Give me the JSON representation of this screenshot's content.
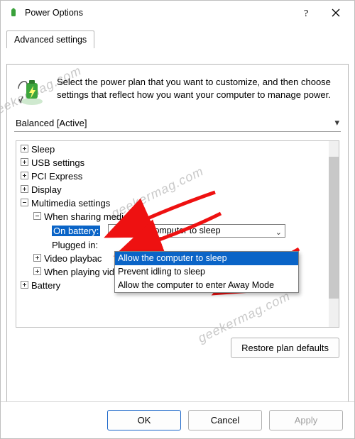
{
  "window": {
    "title": "Power Options"
  },
  "tab": {
    "label": "Advanced settings"
  },
  "intro": {
    "text": "Select the power plan that you want to customize, and then choose settings that reflect how you want your computer to manage power."
  },
  "plan": {
    "selected": "Balanced [Active]"
  },
  "tree": {
    "sleep": "Sleep",
    "usb": "USB settings",
    "pci": "PCI Express",
    "display": "Display",
    "multimedia": "Multimedia settings",
    "sharing": "When sharing media",
    "on_battery_label": "On battery:",
    "on_battery_value": "Allow the computer to sleep",
    "plugged_in_label": "Plugged in:",
    "video_playback": "Video playbac",
    "when_playing": "When playing video",
    "battery": "Battery"
  },
  "dropdown": {
    "opt1": "Allow the computer to sleep",
    "opt2": "Prevent idling to sleep",
    "opt3": "Allow the computer to enter Away Mode"
  },
  "buttons": {
    "restore": "Restore plan defaults",
    "ok": "OK",
    "cancel": "Cancel",
    "apply": "Apply"
  },
  "watermark": "geekermag.com"
}
